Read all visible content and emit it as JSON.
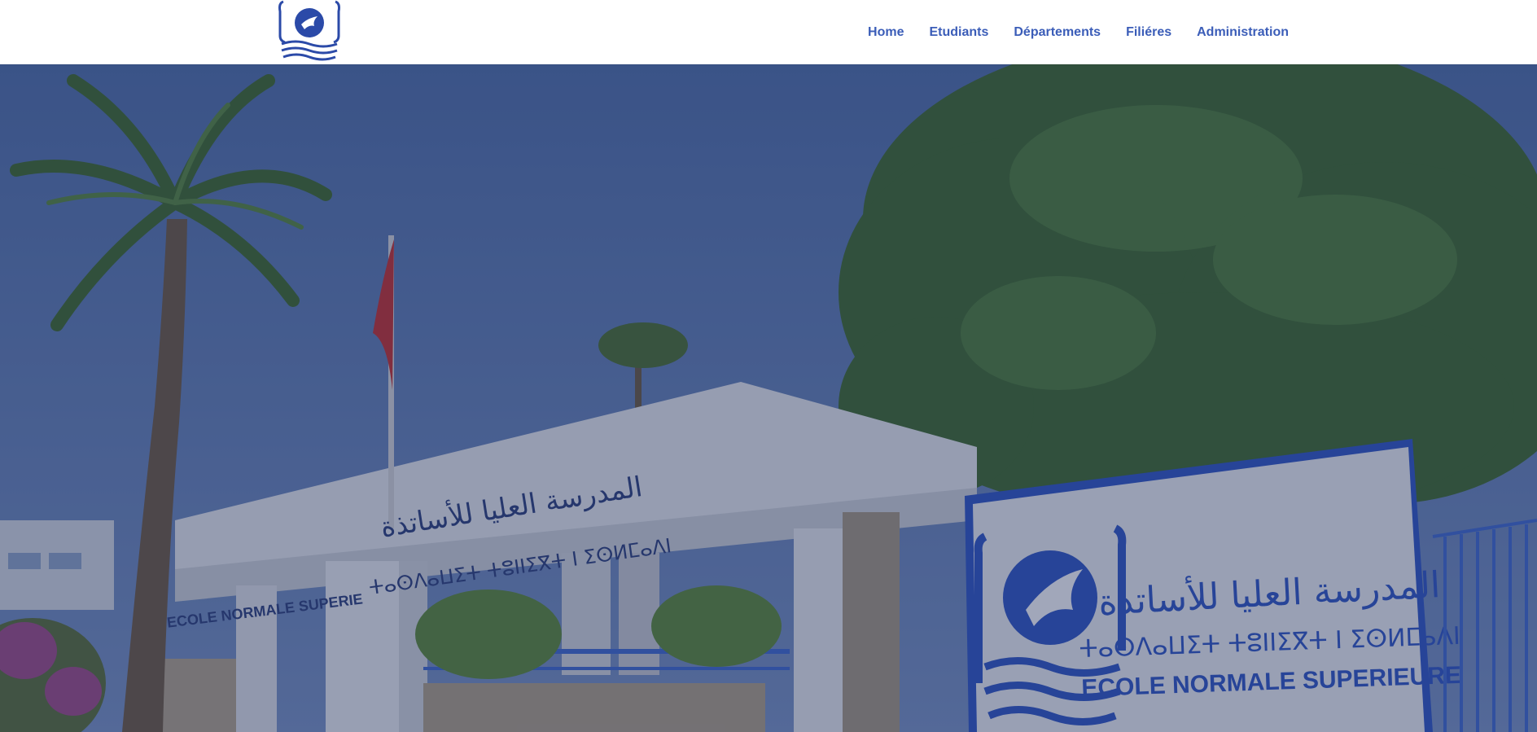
{
  "header": {
    "logo": {
      "icon": "ens-dove-globe-logo"
    },
    "nav": [
      {
        "label": "Home"
      },
      {
        "label": "Etudiants"
      },
      {
        "label": "Départements"
      },
      {
        "label": "Filiéres"
      },
      {
        "label": "Administration"
      }
    ],
    "nav_color": "#3b5db8"
  },
  "hero": {
    "photo": "ens-campus-entrance",
    "overlay_color": "#1e2d5a",
    "gate_text": {
      "arabic": "المدرسة العليا للأساتذة",
      "tifinagh": "ⵜⴰⵙⴷⴰⵡⵉⵜ ⵜⵓⵏⵏⵉⴳⵜ ⵏ ⵉⵙⵍⵎⴰⴷⵏ",
      "latin": "ECOLE NORMALE SUPERIE"
    },
    "sign_text": {
      "arabic": "المدرسة العليا للأساتذة",
      "tifinagh": "ⵜⴰⵙⴷⴰⵡⵉⵜ ⵜⵓⵏⵏⵉⴳⵜ ⵏ ⵉⵙⵍⵎⴰⴷⵏ",
      "latin": "ECOLE NORMALE SUPERIEURE"
    }
  }
}
